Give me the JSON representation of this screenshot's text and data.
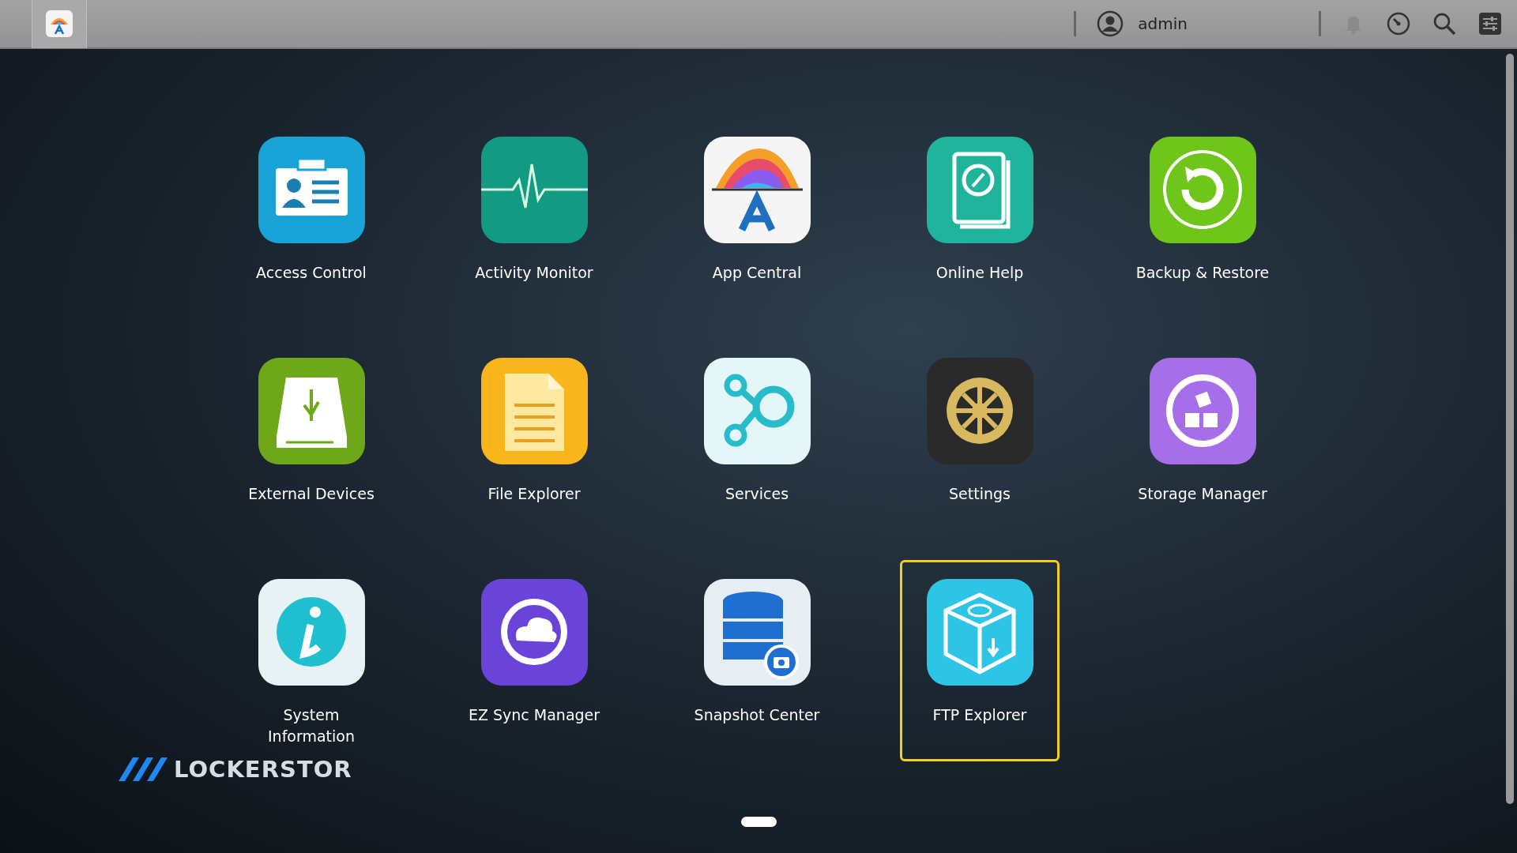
{
  "top_bar": {
    "user": "admin"
  },
  "apps": [
    {
      "label": "Access Control",
      "kind": "access",
      "selected": false
    },
    {
      "label": "Activity Monitor",
      "kind": "activity",
      "selected": false
    },
    {
      "label": "App Central",
      "kind": "appcentral",
      "selected": false
    },
    {
      "label": "Online Help",
      "kind": "help",
      "selected": false
    },
    {
      "label": "Backup & Restore",
      "kind": "backup",
      "selected": false
    },
    {
      "label": "External Devices",
      "kind": "external",
      "selected": false
    },
    {
      "label": "File Explorer",
      "kind": "files",
      "selected": false
    },
    {
      "label": "Services",
      "kind": "services",
      "selected": false
    },
    {
      "label": "Settings",
      "kind": "settings",
      "selected": false
    },
    {
      "label": "Storage Manager",
      "kind": "storage",
      "selected": false
    },
    {
      "label": "System Information",
      "kind": "info",
      "selected": false
    },
    {
      "label": "EZ Sync Manager",
      "kind": "sync",
      "selected": false
    },
    {
      "label": "Snapshot Center",
      "kind": "snapshot",
      "selected": false
    },
    {
      "label": "FTP Explorer",
      "kind": "ftp",
      "selected": true
    }
  ],
  "brand": {
    "logo_text": "LOCKERSTOR"
  }
}
